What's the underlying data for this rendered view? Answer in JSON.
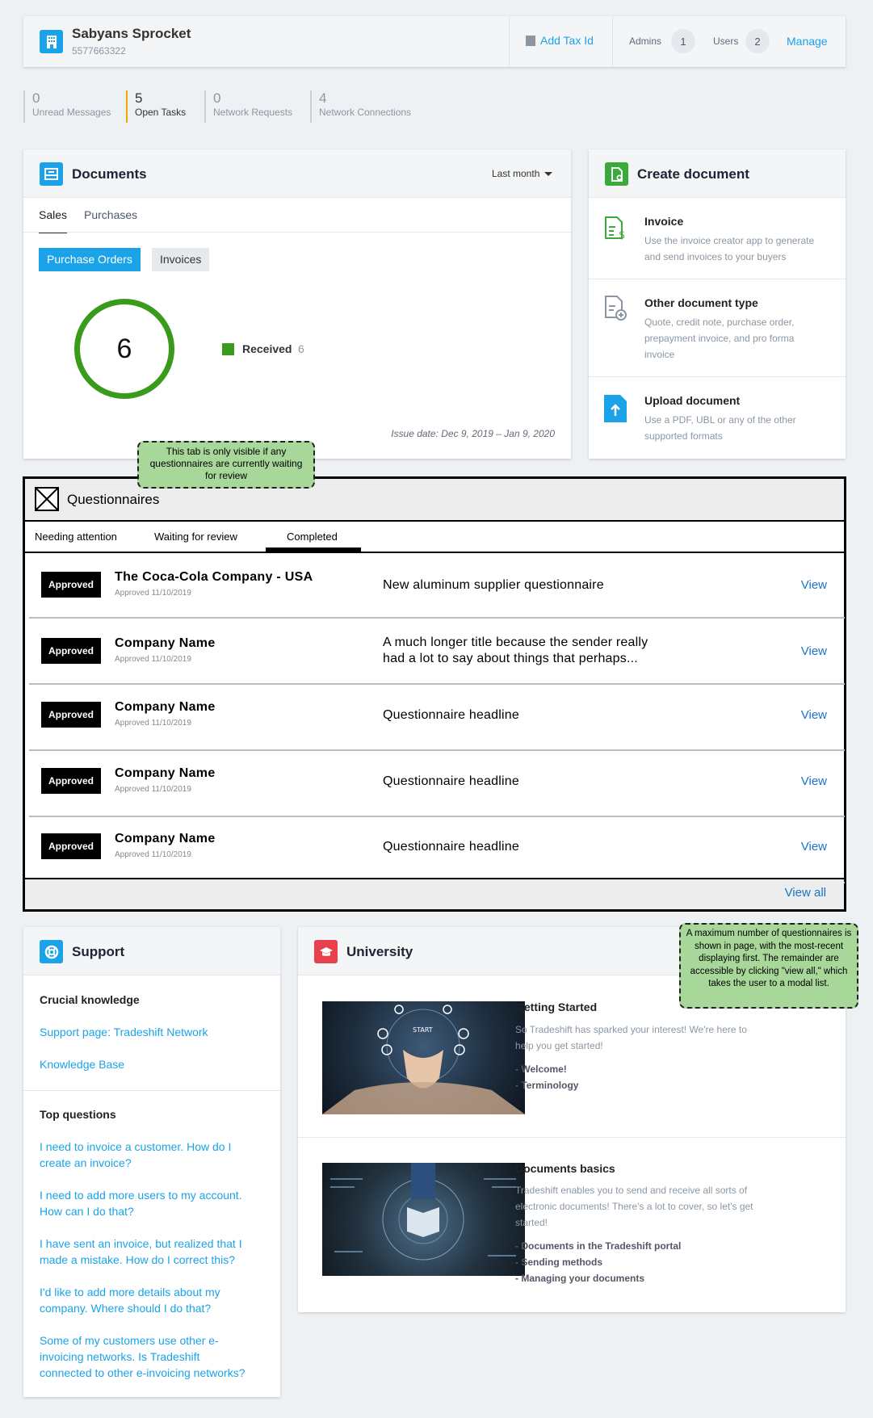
{
  "company": {
    "name": "Sabyans Sprocket",
    "id": "5577663322"
  },
  "header": {
    "add_tax_id": "Add Tax Id",
    "admins_label": "Admins",
    "admins_count": "1",
    "users_label": "Users",
    "users_count": "2",
    "manage": "Manage"
  },
  "stats": [
    {
      "value": "0",
      "label": "Unread Messages"
    },
    {
      "value": "5",
      "label": "Open Tasks"
    },
    {
      "value": "0",
      "label": "Network Requests"
    },
    {
      "value": "4",
      "label": "Network Connections"
    }
  ],
  "documents": {
    "title": "Documents",
    "period": "Last month",
    "tabs": [
      "Sales",
      "Purchases"
    ],
    "buttons": [
      "Purchase Orders",
      "Invoices"
    ],
    "total": "6",
    "legend_label": "Received",
    "legend_value": "6",
    "issue_date": "Issue date: Dec 9, 2019 – Jan 9, 2020"
  },
  "create": {
    "title": "Create document",
    "items": [
      {
        "title": "Invoice",
        "desc": "Use the invoice creator app to generate and send invoices to your buyers"
      },
      {
        "title": "Other document type",
        "desc": "Quote, credit note, purchase order, prepayment invoice, and pro forma invoice"
      },
      {
        "title": "Upload document",
        "desc": "Use a PDF, UBL or any of the other supported formats"
      }
    ]
  },
  "notes": {
    "tab_note": "This tab is only visible if any questionnaires are currently waiting for review",
    "max_note": "A maximum number of questionnaires is shown in page, with the most-recent displaying first. The remainder are accessible by clicking \"view all,\" which takes the user to a modal list."
  },
  "questionnaires": {
    "title": "Questionnaires",
    "tabs": [
      "Needing attention",
      "Waiting for review",
      "Completed"
    ],
    "rows": [
      {
        "status": "Approved",
        "company": "The Coca-Cola Company - USA",
        "date": "Approved 11/10/2019",
        "title": "New aluminum supplier questionnaire",
        "action": "View"
      },
      {
        "status": "Approved",
        "company": "Company Name",
        "date": "Approved 11/10/2019",
        "title": "A much longer title because the sender really had a lot to say about things that perhaps...",
        "action": "View"
      },
      {
        "status": "Approved",
        "company": "Company Name",
        "date": "Approved 11/10/2019",
        "title": "Questionnaire headline",
        "action": "View"
      },
      {
        "status": "Approved",
        "company": "Company Name",
        "date": "Approved 11/10/2019",
        "title": "Questionnaire headline",
        "action": "View"
      },
      {
        "status": "Approved",
        "company": "Company Name",
        "date": "Approved 11/10/2019",
        "title": "Questionnaire headline",
        "action": "View"
      }
    ],
    "view_all": "View all"
  },
  "support": {
    "title": "Support",
    "crucial_title": "Crucial knowledge",
    "crucial_links": [
      "Support page: Tradeshift Network",
      "Knowledge Base"
    ],
    "top_title": "Top questions",
    "questions": [
      "I need to invoice a customer. How do I create an invoice?",
      "I need to add more users to my account. How can I do that?",
      "I have sent an invoice, but realized that I made a mistake. How do I correct this?",
      "I'd like to add more details about my company. Where should I do that?",
      "Some of my customers use other e-invoicing networks. Is Tradeshift connected to other e-invoicing networks?"
    ]
  },
  "university": {
    "title": "University",
    "courses": [
      {
        "title": "Getting Started",
        "desc": "So Tradeshift has sparked your interest! We're here to help you get started!",
        "links": [
          "- Welcome!",
          "- Terminology"
        ],
        "image_text": "START"
      },
      {
        "title": "Documents basics",
        "desc": "Tradeshift enables you to send and receive all sorts of electronic documents! There's a lot to cover, so let's get started!",
        "links": [
          "- Documents in the Tradeshift portal",
          "- Sending methods",
          "- Managing your documents"
        ]
      }
    ]
  },
  "colors": {
    "accent": "#1aa3e8",
    "green": "#3a9a1c",
    "red": "#e8414b",
    "note": "#a8d79a"
  }
}
